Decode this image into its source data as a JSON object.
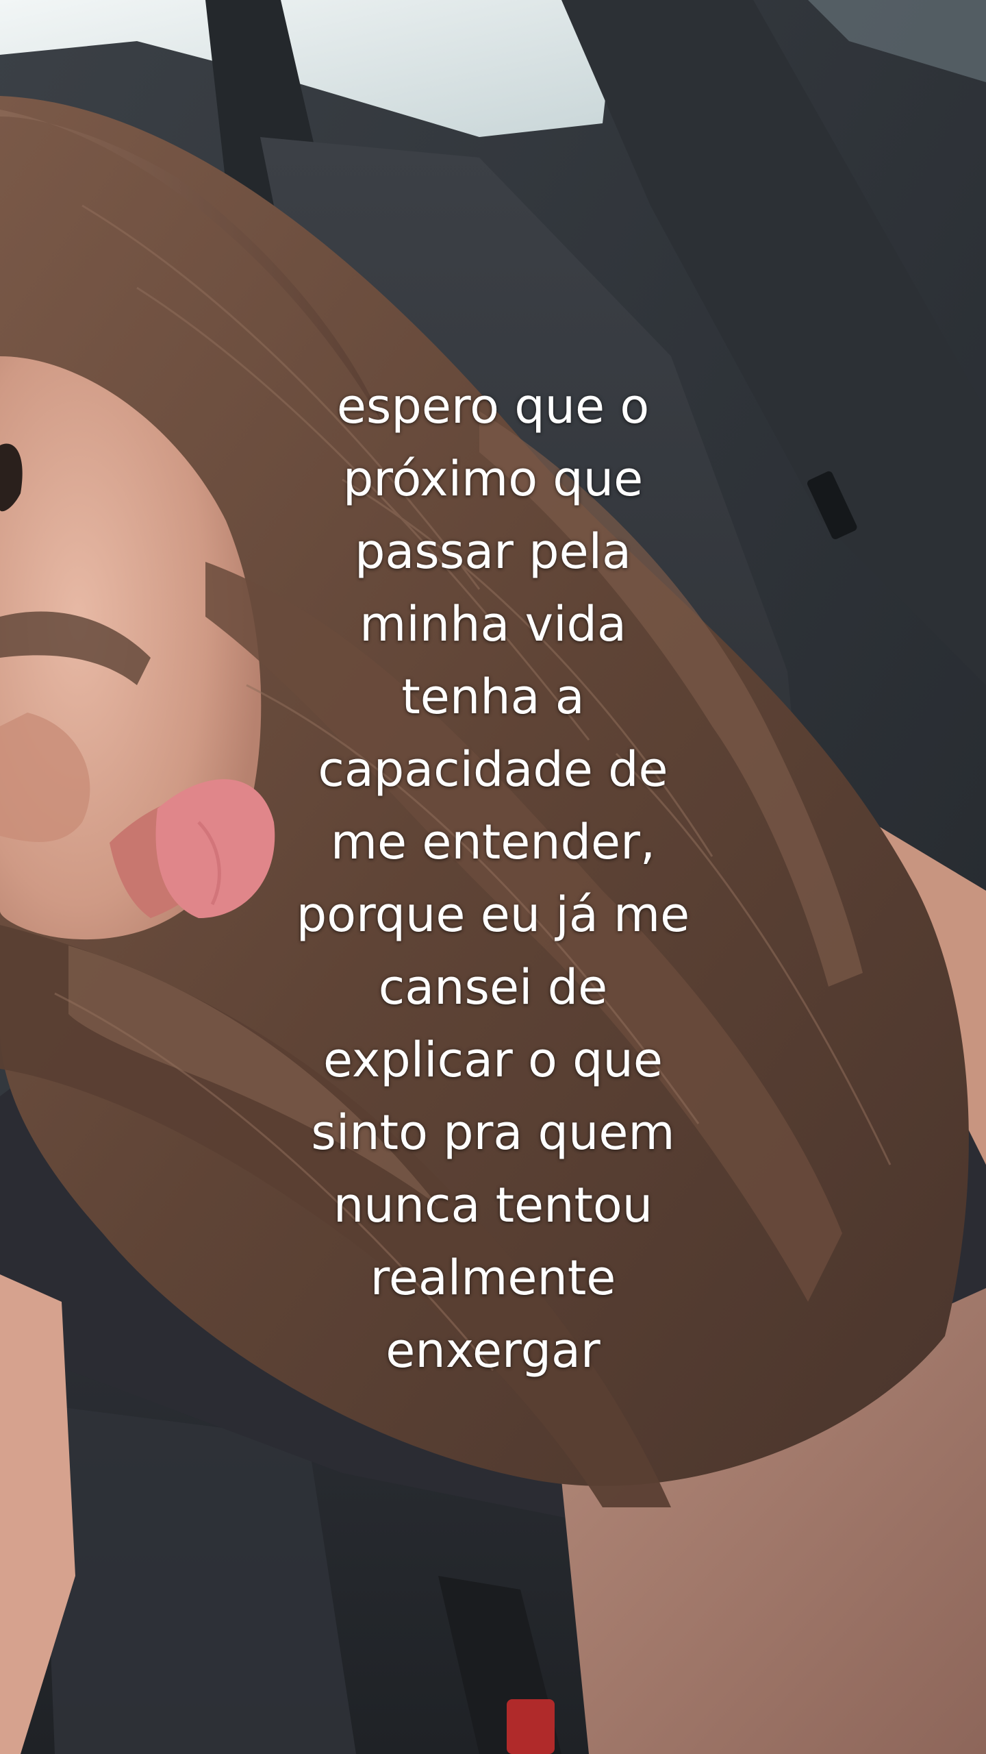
{
  "caption": {
    "lines": [
      "espero que o",
      "próximo que",
      "passar pela",
      "minha vida",
      "tenha a",
      "capacidade de",
      "me entender,",
      "porque eu já me",
      "cansei de",
      "explicar o que",
      "sinto pra quem",
      "nunca tentou",
      "realmente",
      "enxergar"
    ]
  },
  "colors": {
    "caption_text": "#ffffff",
    "hair": "#6b4c3b",
    "car_interior": "#3a3d42",
    "window_light": "#e6eef0",
    "top_shirt": "#2b2c33",
    "skin": "#d9a48f",
    "bottom_fabric": "#a27a6c"
  }
}
